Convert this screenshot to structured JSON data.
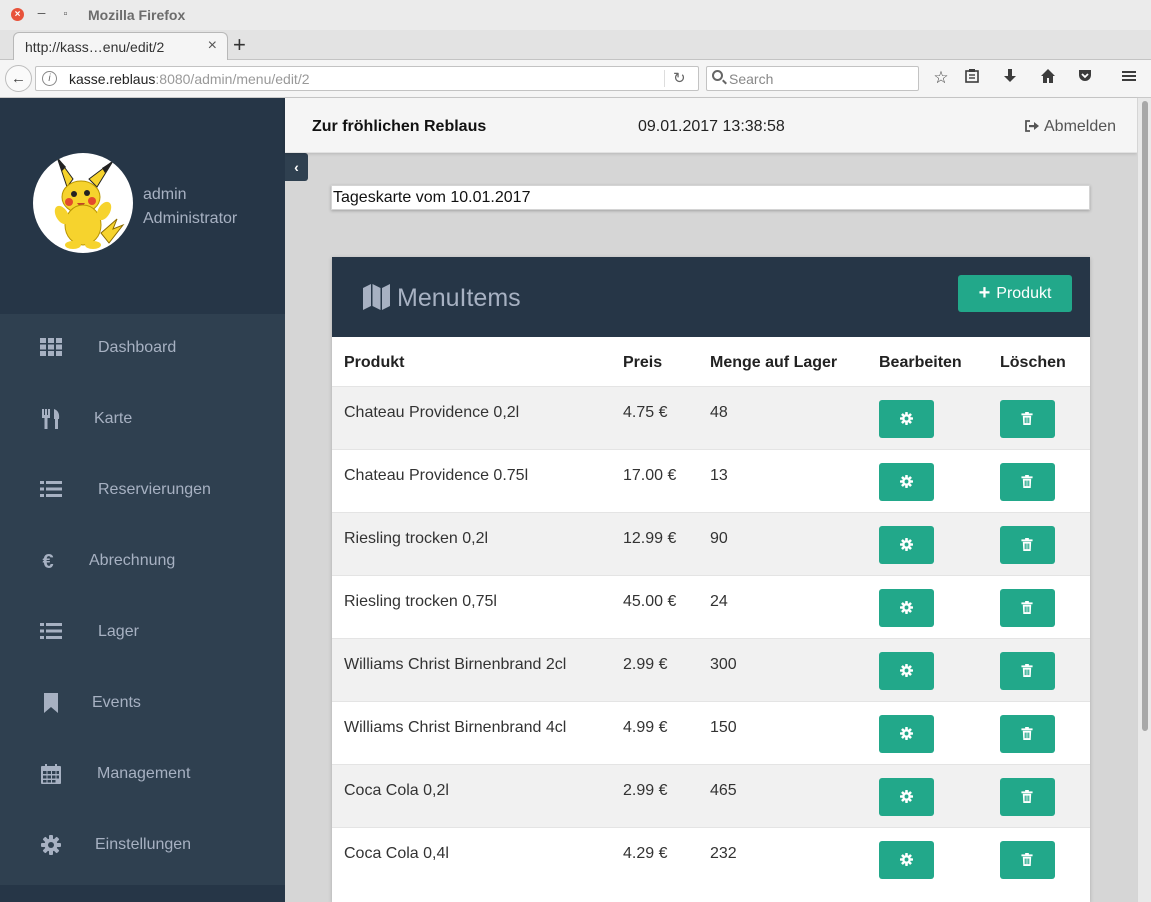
{
  "browser": {
    "window_title": "Mozilla Firefox",
    "tab_title": "http://kass…enu/edit/2",
    "url_host": "kasse.reblaus",
    "url_rest": ":8080/admin/menu/edit/2",
    "search_placeholder": "Search"
  },
  "user": {
    "name": "admin",
    "role": "Administrator"
  },
  "sidebar": {
    "items": [
      {
        "label": "Dashboard",
        "icon": "th-icon"
      },
      {
        "label": "Karte",
        "icon": "cutlery-icon"
      },
      {
        "label": "Reservierungen",
        "icon": "list-icon"
      },
      {
        "label": "Abrechnung",
        "icon": "euro-icon"
      },
      {
        "label": "Lager",
        "icon": "list-icon"
      },
      {
        "label": "Events",
        "icon": "bookmark-icon"
      },
      {
        "label": "Management",
        "icon": "calendar-icon"
      },
      {
        "label": "Einstellungen",
        "icon": "gear-icon"
      }
    ]
  },
  "header": {
    "title": "Zur fröhlichen Reblaus",
    "datetime": "09.01.2017 13:38:58",
    "logout": "Abmelden"
  },
  "tageskarte": {
    "value": "Tageskarte vom 10.01.2017"
  },
  "panel": {
    "title": "MenuItems",
    "add_button": "Produkt",
    "columns": [
      "Produkt",
      "Preis",
      "Menge auf Lager",
      "Bearbeiten",
      "Löschen"
    ],
    "rows": [
      {
        "produkt": "Chateau Providence 0,2l",
        "preis": "4.75 €",
        "menge": "48"
      },
      {
        "produkt": "Chateau Providence 0.75l",
        "preis": "17.00 €",
        "menge": "13"
      },
      {
        "produkt": "Riesling trocken 0,2l",
        "preis": "12.99 €",
        "menge": "90"
      },
      {
        "produkt": "Riesling trocken 0,75l",
        "preis": "45.00 €",
        "menge": "24"
      },
      {
        "produkt": "Williams Christ Birnenbrand 2cl",
        "preis": "2.99 €",
        "menge": "300"
      },
      {
        "produkt": "Williams Christ Birnenbrand 4cl",
        "preis": "4.99 €",
        "menge": "150"
      },
      {
        "produkt": "Coca Cola 0,2l",
        "preis": "2.99 €",
        "menge": "465"
      },
      {
        "produkt": "Coca Cola 0,4l",
        "preis": "4.29 €",
        "menge": "232"
      }
    ]
  },
  "colors": {
    "sidebar": "#2f4050",
    "sidebar_dark": "#263647",
    "accent": "#22a88a"
  }
}
